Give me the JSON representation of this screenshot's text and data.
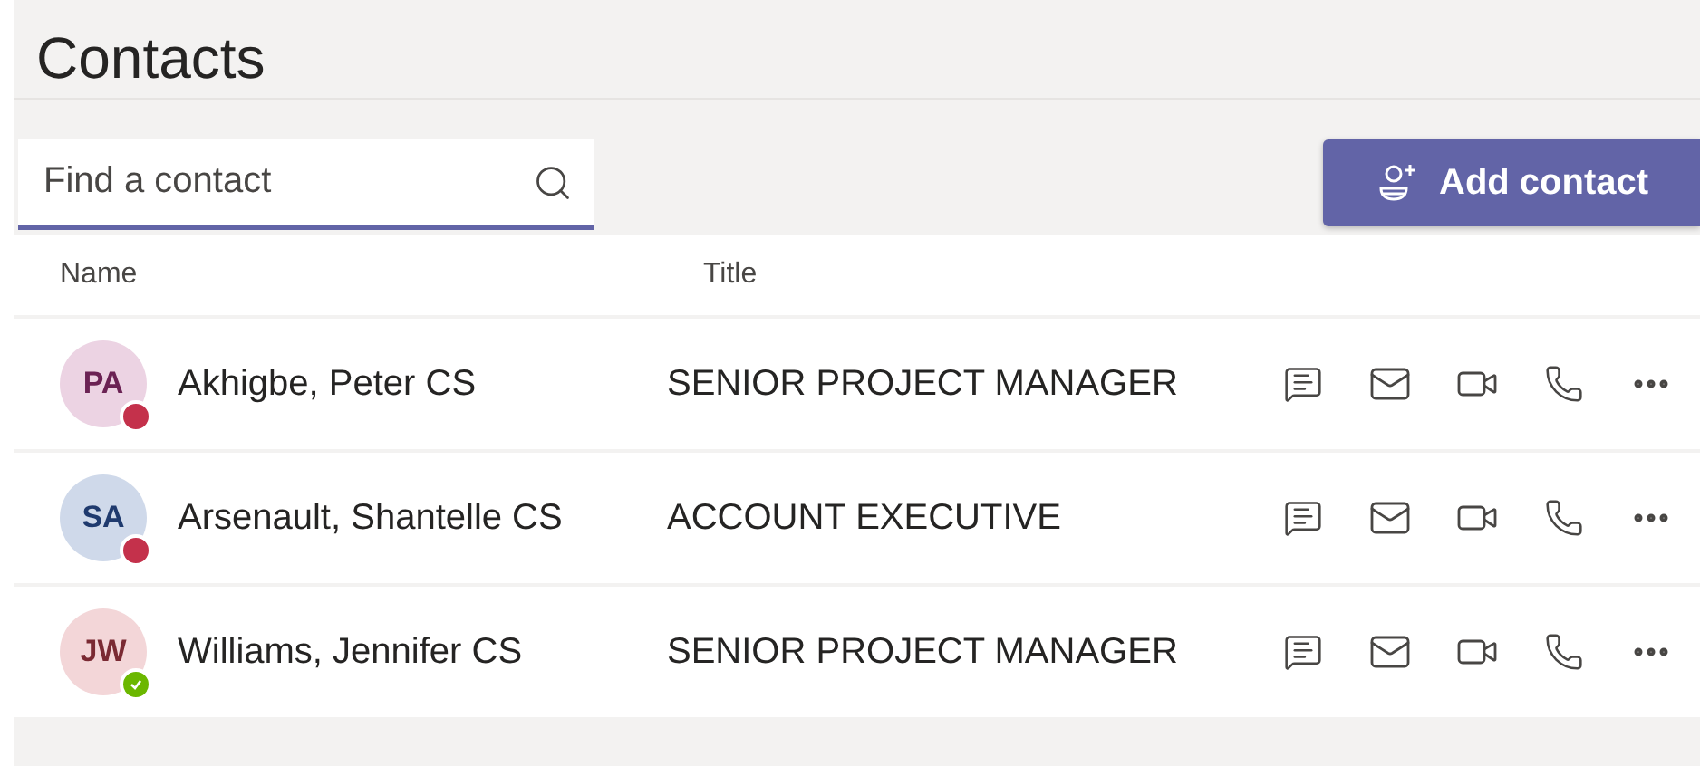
{
  "title": "Contacts",
  "search": {
    "placeholder": "Find a contact"
  },
  "add_button": {
    "label": "Add contact"
  },
  "table": {
    "columns": [
      "Name",
      "Title"
    ],
    "rows": [
      {
        "initials": "PA",
        "name": "Akhigbe, Peter CS",
        "title": "SENIOR PROJECT MANAGER",
        "color": "#c4314b",
        "available": false
      },
      {
        "initials": "SA",
        "name": "Arsenault, Shantelle CS",
        "title": "ACCOUNT EXECUTIVE",
        "color": "#c4314b",
        "available": false
      },
      {
        "initials": "JW",
        "name": "Williams, Jennifer CS",
        "title": "SENIOR PROJECT MANAGER",
        "color": "#6bb700",
        "available": true
      }
    ]
  }
}
